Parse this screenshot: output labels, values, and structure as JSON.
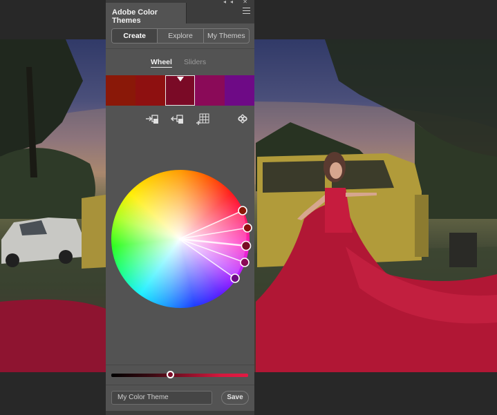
{
  "panel": {
    "title": "Adobe Color Themes",
    "mode_tabs": [
      {
        "label": "Create",
        "active": true
      },
      {
        "label": "Explore",
        "active": false
      },
      {
        "label": "My Themes",
        "active": false
      }
    ],
    "view_tabs": [
      {
        "label": "Wheel",
        "active": true
      },
      {
        "label": "Sliders",
        "active": false
      }
    ],
    "swatches": [
      "#8a1808",
      "#8e1010",
      "#7a0a26",
      "#8a0a58",
      "#6e0a86"
    ],
    "selected_swatch_index": 2,
    "tools": [
      "add-to-swatches-icon",
      "set-from-swatch-icon",
      "add-to-grid-icon",
      "color-harmony-icon"
    ],
    "brightness_level": 0.43,
    "theme_name_placeholder": "My Color Theme",
    "save_label": "Save",
    "colors": {
      "panel_bg": "#535353",
      "header_bg": "#3c3c3c",
      "workspace_bg": "#282828"
    }
  },
  "canvas": {
    "photo_subject": "woman in long red dress beside yellow van"
  }
}
